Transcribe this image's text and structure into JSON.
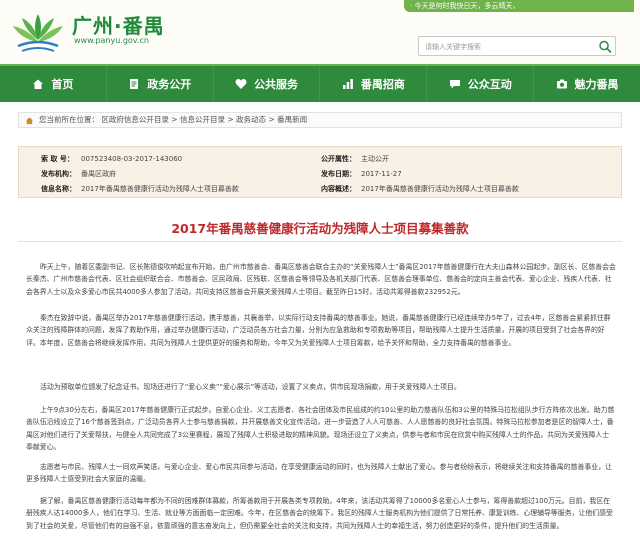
{
  "header": {
    "title": "广州·番禺",
    "url": "www.panyu.gov.cn",
    "slogan": "· 今天是何时我快日天，多云晴天，",
    "search_placeholder": "请输入关键字搜索",
    "brand_color": "#2f8a3d"
  },
  "nav": {
    "items": [
      {
        "label": "首页",
        "icon": "home-icon"
      },
      {
        "label": "政务公开",
        "icon": "document-icon"
      },
      {
        "label": "公共服务",
        "icon": "heart-icon"
      },
      {
        "label": "番禺招商",
        "icon": "chart-icon"
      },
      {
        "label": "公众互动",
        "icon": "chat-icon"
      },
      {
        "label": "魅力番禺",
        "icon": "camera-icon"
      }
    ]
  },
  "breadcrumb": {
    "prefix": "您当前所在位置：",
    "items": [
      "区政府信息公开目录",
      "信息公开目录",
      "政务动态",
      "番禺新闻"
    ],
    "sep": " > "
  },
  "info": {
    "index_label": "索 取 号：",
    "index_value": "007523408-03-2017-143060",
    "category_label": "公开属性：",
    "category_value": "主动公开",
    "publisher_label": "发布机构：",
    "publisher_value": "番禺区政府",
    "date_label": "发布日期：",
    "date_value": "2017-11-27",
    "name_label": "信息名称：",
    "name_value": "2017年番禺慈善健康行活动为残障人士项目募善款",
    "summary_label": "内容概述：",
    "summary_value": "2017年番禺慈善健康行活动为残障人士项目募善款"
  },
  "article": {
    "title": "2017年番禺慈善健康行活动为残障人士项目募集善款",
    "paragraphs": [
      "昨天上午，随着区委副书记、区长陈德俊吹响起宣布开始，由广州市慈善会、番禺区慈善会联合主办的“关爱残障人士”番禺区2017年慈善健康行在大夫山森林公园起步。副区长、区慈善会会长秦杰、广州市慈善会代表、区社会组织联合会、市慈善会、区民政局、区残联、区慈善会等领导及各机关部门代表、区慈善会理事单位、慈善会的定向主善会代表、爱心企业、残疾人代表、社会各界人士以及众多爱心市民共4000多人参加了活动，共同支持区慈善会开展关爱残障人士项目。截至昨日15时，活动共筹得善款232952元。",
      "秦杰在致辞中说，番禺区举办2017年慈善健康行活动，携手慈善，共襄善举，以实际行动支持番禺的慈善事业。她说，番禺慈善健康行已经连续举办5年了，过去4年，区慈善会紧紧抓住群众关注的残障群体的问题，发挥了救助作用，通过举办健康行活动，广泛动员各方社会力量，分别为应急救助和专项救助等项目，帮助残障人士提升生活质量，开展的项目受到了社会各界的好评。本年度，区慈善会将继续发挥作用，共同为残障人士提供更好的服务和帮助，今年又为关爱残障人士项目筹款，给予关怀和帮助，全力支持番禺的慈善事业。",
      "活动为预取单位颁发了纪念证书。现场还进行了“爱心义卖”“爱心展示”等活动，设置了义卖点，供市民现场捐款，用于关爱残障人士项目。",
      "上午9点30分左右，番禺区2017年慈善健康行正式起步。自爱心企业、义工志愿者、各社会团体及市民组成的约10公里的助力慈善队伍和3公里的特殊马拉松组队步行方阵依次出发。助力慈善队伍沿线设立了16个慈善签到点，广泛动员各界人士参与慈善捐款，并开展慈善文化宣传活动，进一步营造了人人可慈善、人人愿慈善的良好社会氛围。特殊马拉松参加者是区的智障人士，番禺区对他们进行了关爱帮扶，与健全人共同完成了3公里赛程，展现了残障人士积极进取的精神风貌。现场还设立了义卖点，供参与者和市民在欣赏中购买残障人士的作品，共同为关爱残障人士奉献爱心。",
      "志愿者与市民、残障人士一同欢声笑语，与爱心企业、爱心市民共同参与活动，在享受健康运动的同时，也为残障人士献出了爱心。参与者纷纷表示，将继续关注和支持番禺的慈善事业，让更多残障人士感受到社会大家庭的温暖。",
      "据了解，番禺区慈善健康行活动每年都为不同的困难群体募款，所筹善款用于开展各类专项救助。4年来，该活动共筹得了10000多名爱心人士参与，筹得善款超过100万元。目前，我区在册残疾人达14000多人，他们在学习、生活、就业等方面面临一定困难。今年，在区慈善会的统筹下，我区的残障人士服务机构为他们提供了日常托养、康复训练、心理辅导等服务，让他们感受到了社会的关爱，尽管他们有的自强不息，依靠顽强的意志奋发向上，但仍需要全社会的关注和支持，共同为残障人士的幸福生活，努力创造更好的条件，提升他们的生活质量。"
    ]
  }
}
